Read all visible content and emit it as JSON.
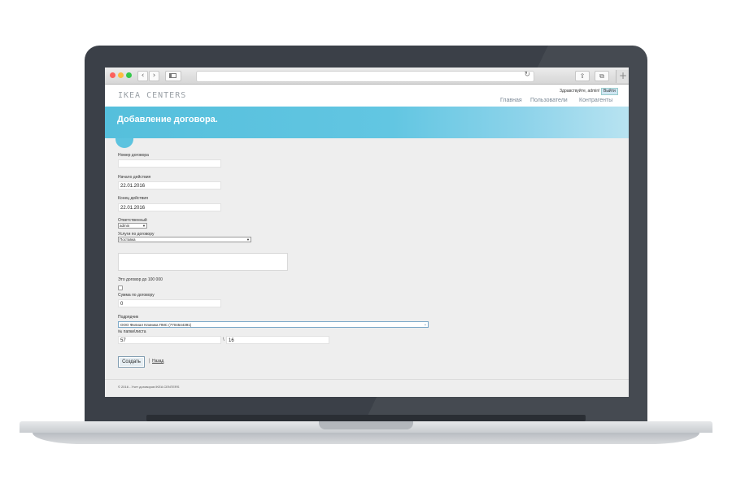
{
  "browser": {
    "back_glyph": "‹",
    "forward_glyph": "›",
    "reload_glyph": "↻",
    "share_glyph": "⇪",
    "tabs_glyph": "⧉",
    "new_tab_glyph": "+"
  },
  "site": {
    "logo": "IKEA CENTERS",
    "greeting": "Здравствуйте, admin!",
    "logout_label": "Выйти",
    "menu": [
      "Главная",
      "Пользователи",
      "Контрагенты"
    ]
  },
  "page": {
    "title": "Добавление договора."
  },
  "form": {
    "contract_number_label": "Номер договора",
    "contract_number_value": "",
    "start_label": "Начало действия",
    "start_value": "22.01.2016",
    "end_label": "Конец действия",
    "end_value": "22.01.2016",
    "responsible_label": "Ответственный",
    "responsible_value": "admin",
    "services_label": "Услуги по договору",
    "services_value": "Поставка",
    "under_100k_label": "Это договор до 100 000",
    "under_100k_checked": false,
    "amount_label": "Сумма по договору",
    "amount_value": "0",
    "contractor_label": "Подрядчик",
    "contractor_value": "ООО Филиал Клиника ПМС (7704544391)",
    "folder_sheet_label": "№ папки\\листа",
    "folder_value": "57",
    "slash": "\\",
    "sheet_value": "16",
    "create_label": "Создать",
    "separator": "|",
    "back_label": "Назад"
  },
  "footer": {
    "text": "© 2016 - Учет договоров IKEA CENTERS"
  },
  "colors": {
    "banner": "#55bfdc",
    "bezel": "#3b4048",
    "page_background": "#eeeeee"
  }
}
